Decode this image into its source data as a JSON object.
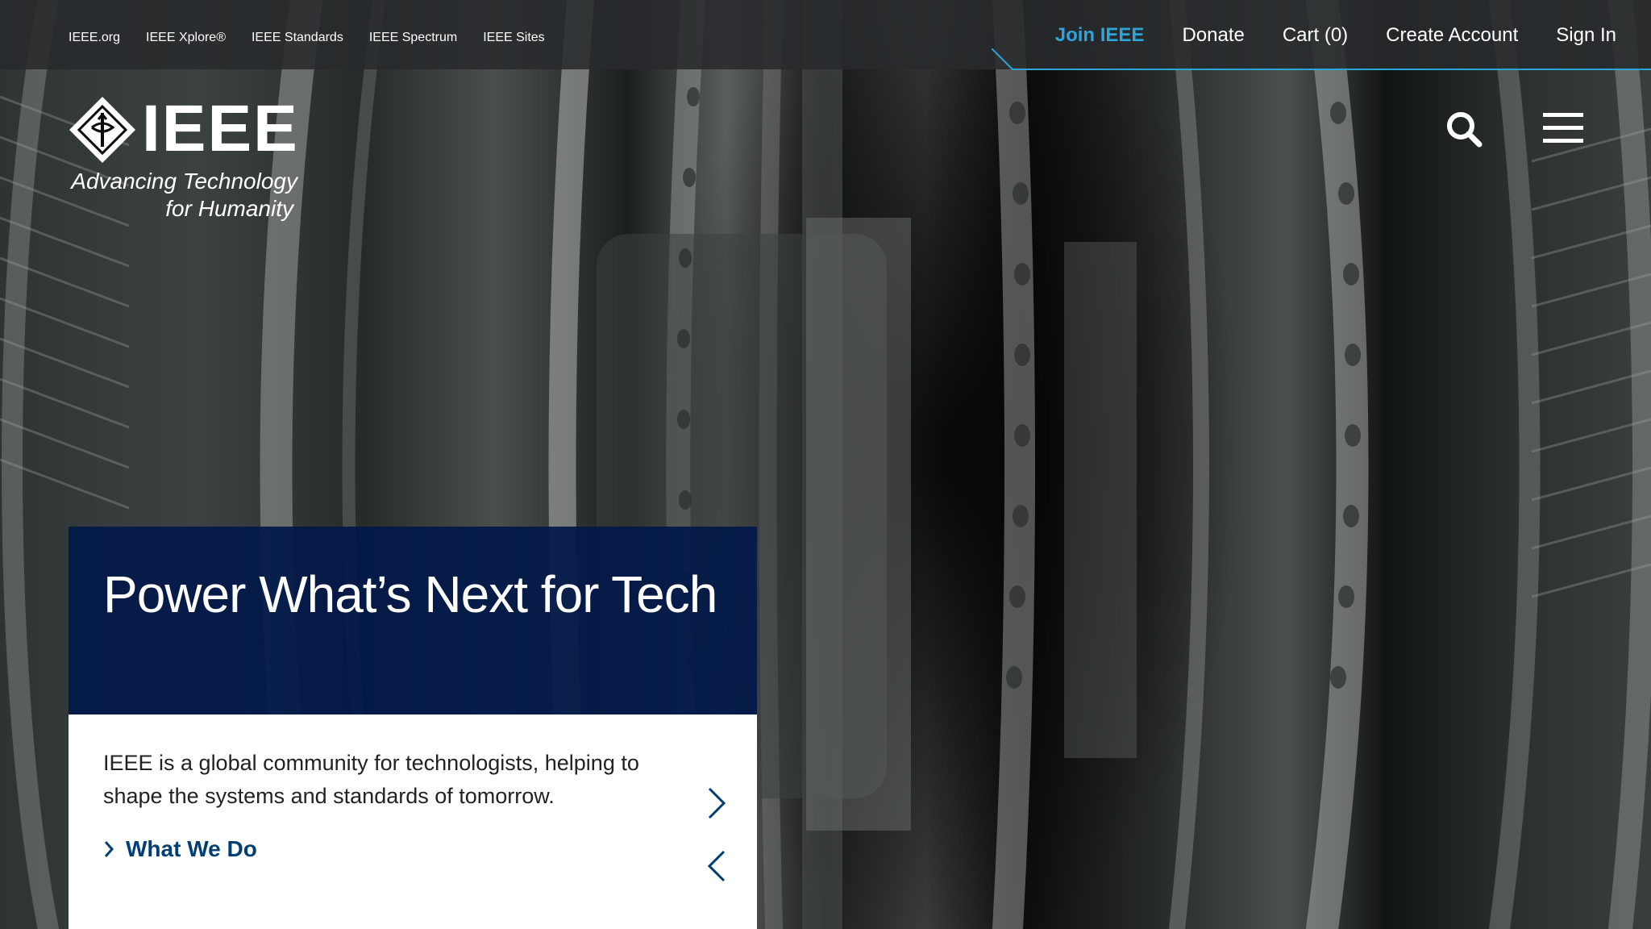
{
  "utility_nav": {
    "links": [
      "IEEE.org",
      "IEEE Xplore®",
      "IEEE Standards",
      "IEEE Spectrum",
      "IEEE Sites"
    ]
  },
  "account_nav": {
    "join": "Join IEEE",
    "donate": "Donate",
    "cart": "Cart (0)",
    "create_account": "Create Account",
    "sign_in": "Sign In"
  },
  "logo": {
    "wordmark": "IEEE",
    "tagline_line1": "Advancing Technology",
    "tagline_line2": "for Humanity"
  },
  "header_icons": {
    "search": "search-icon",
    "menu": "hamburger-menu-icon"
  },
  "hero": {
    "title": "Power What’s Next for Tech",
    "description": "IEEE is a global community for technologists, helping to shape the systems and standards of tomorrow.",
    "cta_label": "What We Do"
  },
  "colors": {
    "utility_bar": "#28292c",
    "join_accent": "#2da5d8",
    "card_title_bg": "#021948",
    "cta_text": "#003f74"
  }
}
